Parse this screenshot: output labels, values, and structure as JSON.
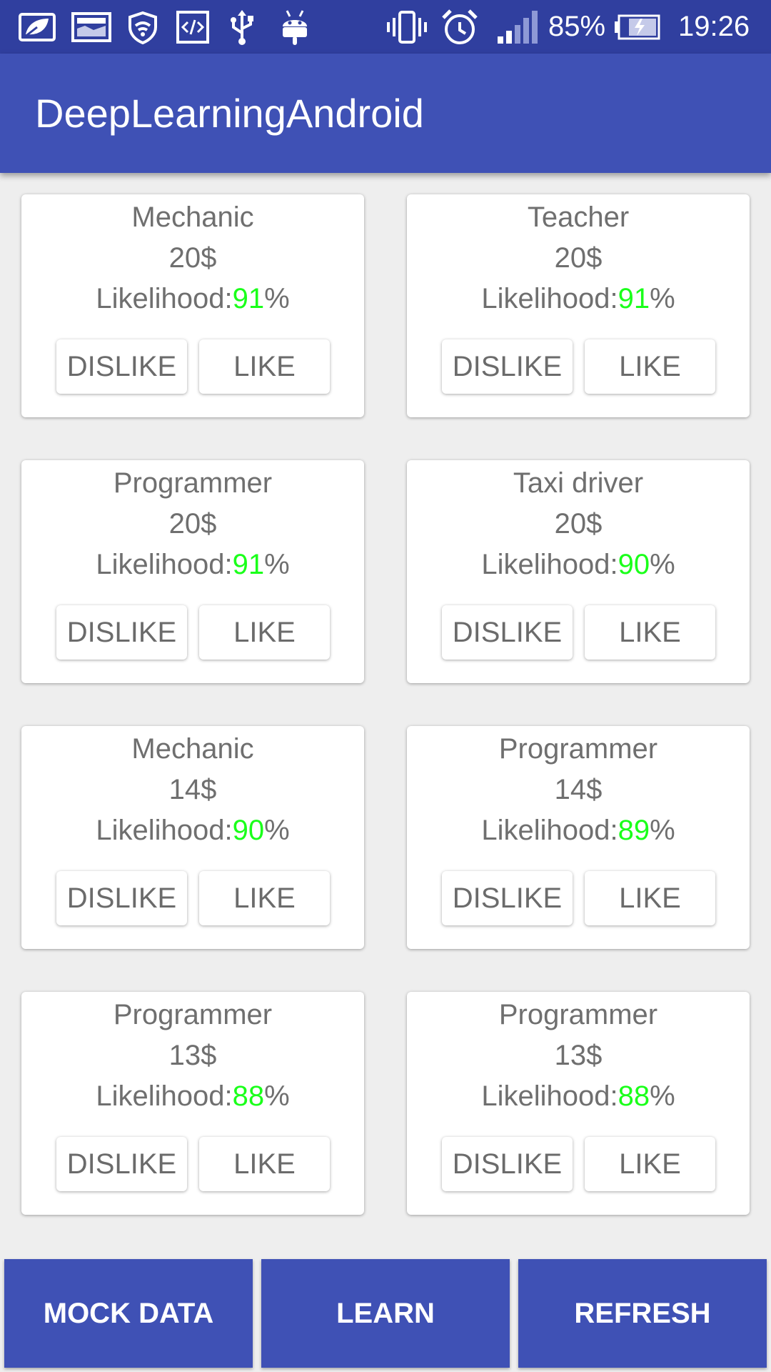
{
  "status_bar": {
    "battery_percent": "85%",
    "time": "19:26",
    "icons": [
      "leaf-icon",
      "image-icon",
      "vpn-shield-icon",
      "code-icon",
      "usb-icon",
      "android-icon",
      "vibrate-icon",
      "alarm-icon",
      "signal-icon",
      "battery-charging-icon"
    ]
  },
  "app_bar": {
    "title": "DeepLearningAndroid"
  },
  "cards": [
    {
      "title": "Mechanic",
      "price": "20$",
      "likelihood_label": "Likelihood:",
      "likelihood_value": "91",
      "percent_sign": "%",
      "dislike_label": "DISLIKE",
      "like_label": "LIKE"
    },
    {
      "title": "Teacher",
      "price": "20$",
      "likelihood_label": "Likelihood:",
      "likelihood_value": "91",
      "percent_sign": "%",
      "dislike_label": "DISLIKE",
      "like_label": "LIKE"
    },
    {
      "title": "Programmer",
      "price": "20$",
      "likelihood_label": "Likelihood:",
      "likelihood_value": "91",
      "percent_sign": "%",
      "dislike_label": "DISLIKE",
      "like_label": "LIKE"
    },
    {
      "title": "Taxi driver",
      "price": "20$",
      "likelihood_label": "Likelihood:",
      "likelihood_value": "90",
      "percent_sign": "%",
      "dislike_label": "DISLIKE",
      "like_label": "LIKE"
    },
    {
      "title": "Mechanic",
      "price": "14$",
      "likelihood_label": "Likelihood:",
      "likelihood_value": "90",
      "percent_sign": "%",
      "dislike_label": "DISLIKE",
      "like_label": "LIKE"
    },
    {
      "title": "Programmer",
      "price": "14$",
      "likelihood_label": "Likelihood:",
      "likelihood_value": "89",
      "percent_sign": "%",
      "dislike_label": "DISLIKE",
      "like_label": "LIKE"
    },
    {
      "title": "Programmer",
      "price": "13$",
      "likelihood_label": "Likelihood:",
      "likelihood_value": "88",
      "percent_sign": "%",
      "dislike_label": "DISLIKE",
      "like_label": "LIKE"
    },
    {
      "title": "Programmer",
      "price": "13$",
      "likelihood_label": "Likelihood:",
      "likelihood_value": "88",
      "percent_sign": "%",
      "dislike_label": "DISLIKE",
      "like_label": "LIKE"
    }
  ],
  "bottom_bar": {
    "mock_data_label": "MOCK DATA",
    "learn_label": "LEARN",
    "refresh_label": "REFRESH"
  },
  "colors": {
    "status_bar": "#303f9f",
    "primary": "#3f51b5",
    "background": "#eeeeee",
    "likelihood_value": "#1aff1a",
    "text_grey": "#6f6f6f"
  }
}
